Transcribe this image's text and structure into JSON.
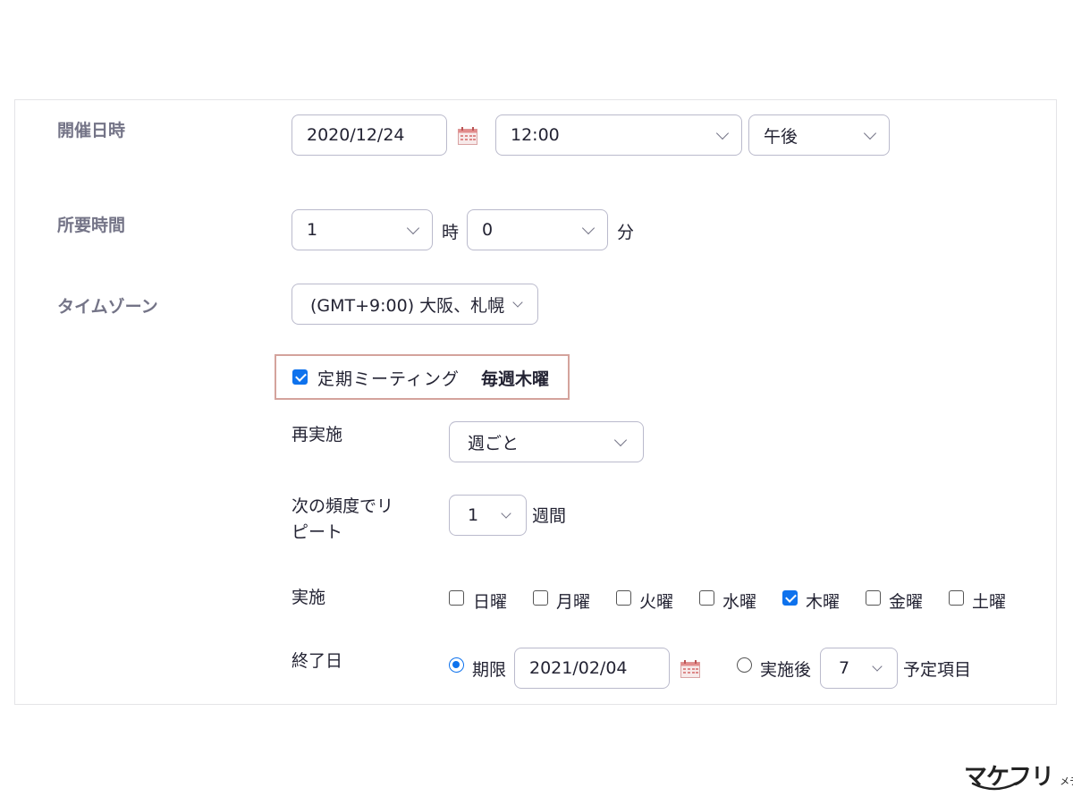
{
  "schedule": {
    "date_label": "開催日時",
    "date_value": "2020/12/24",
    "time_value": "12:00",
    "ampm_value": "午後"
  },
  "duration": {
    "label": "所要時間",
    "hours_value": "1",
    "hours_unit": "時",
    "minutes_value": "0",
    "minutes_unit": "分"
  },
  "timezone": {
    "label": "タイムゾーン",
    "value": "(GMT+9:00) 大阪、札幌"
  },
  "recurring": {
    "checkbox_label": "定期ミーティング",
    "summary": "毎週木曜",
    "checked": true
  },
  "recurrence": {
    "label": "再実施",
    "value": "週ごと"
  },
  "repeat_every": {
    "label_line1": "次の頻度でリ",
    "label_line2": "ピート",
    "value": "1",
    "unit": "週間"
  },
  "days": {
    "label": "実施",
    "items": [
      {
        "label": "日曜",
        "checked": false
      },
      {
        "label": "月曜",
        "checked": false
      },
      {
        "label": "火曜",
        "checked": false
      },
      {
        "label": "水曜",
        "checked": false
      },
      {
        "label": "木曜",
        "checked": true
      },
      {
        "label": "金曜",
        "checked": false
      },
      {
        "label": "土曜",
        "checked": false
      }
    ]
  },
  "end_date": {
    "label": "終了日",
    "by_label": "期限",
    "by_value": "2021/02/04",
    "after_label": "実施後",
    "after_value": "7",
    "after_unit": "予定項目",
    "selected": "by"
  },
  "logo": {
    "main": "マケフリ",
    "sub": "メディア"
  },
  "colors": {
    "accent": "#0e72ed",
    "highlight_border": "#d4a39c",
    "label_gray": "#747487",
    "field_border": "#babacc"
  }
}
